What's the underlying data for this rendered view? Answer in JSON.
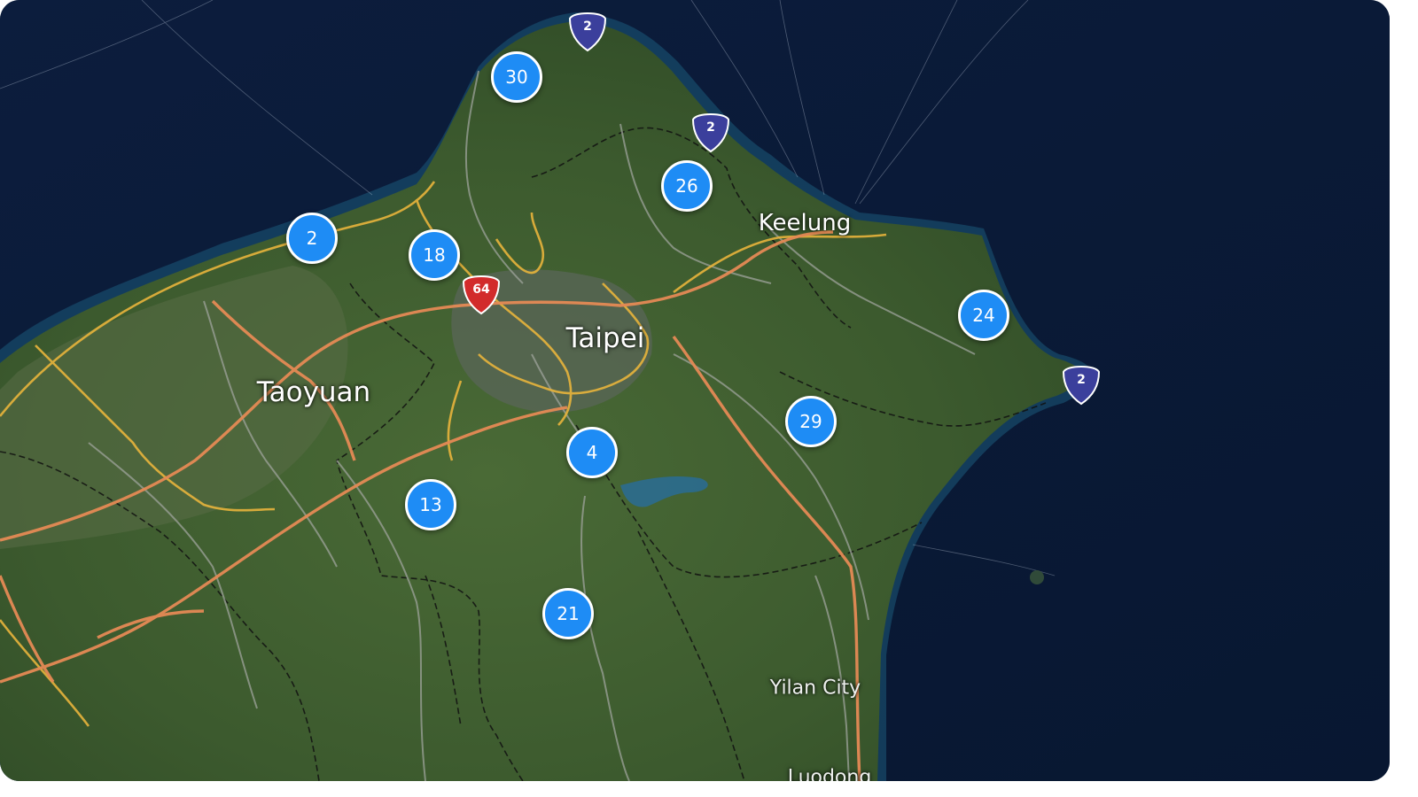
{
  "map": {
    "cities": [
      {
        "name": "Taipei",
        "tier": "major"
      },
      {
        "name": "Taoyuan",
        "tier": "major"
      },
      {
        "name": "Keelung",
        "tier": "mid"
      },
      {
        "name": "Yilan City",
        "tier": "minor"
      },
      {
        "name": "Luodong",
        "tier": "minor"
      }
    ],
    "clusters": [
      {
        "count": "30"
      },
      {
        "count": "26"
      },
      {
        "count": "2"
      },
      {
        "count": "18"
      },
      {
        "count": "24"
      },
      {
        "count": "29"
      },
      {
        "count": "4"
      },
      {
        "count": "13"
      },
      {
        "count": "21"
      }
    ],
    "route_shields": [
      {
        "number": "2",
        "type": "provincial-highway"
      },
      {
        "number": "2",
        "type": "provincial-highway"
      },
      {
        "number": "2",
        "type": "provincial-highway"
      },
      {
        "number": "64",
        "type": "expressway"
      }
    ],
    "colors": {
      "cluster": "#1e8cf5",
      "provincial_shield": "#3b3f9c",
      "expressway_shield": "#d22b2b",
      "sea": "#0a1a38",
      "land": "#3d5e30"
    }
  }
}
